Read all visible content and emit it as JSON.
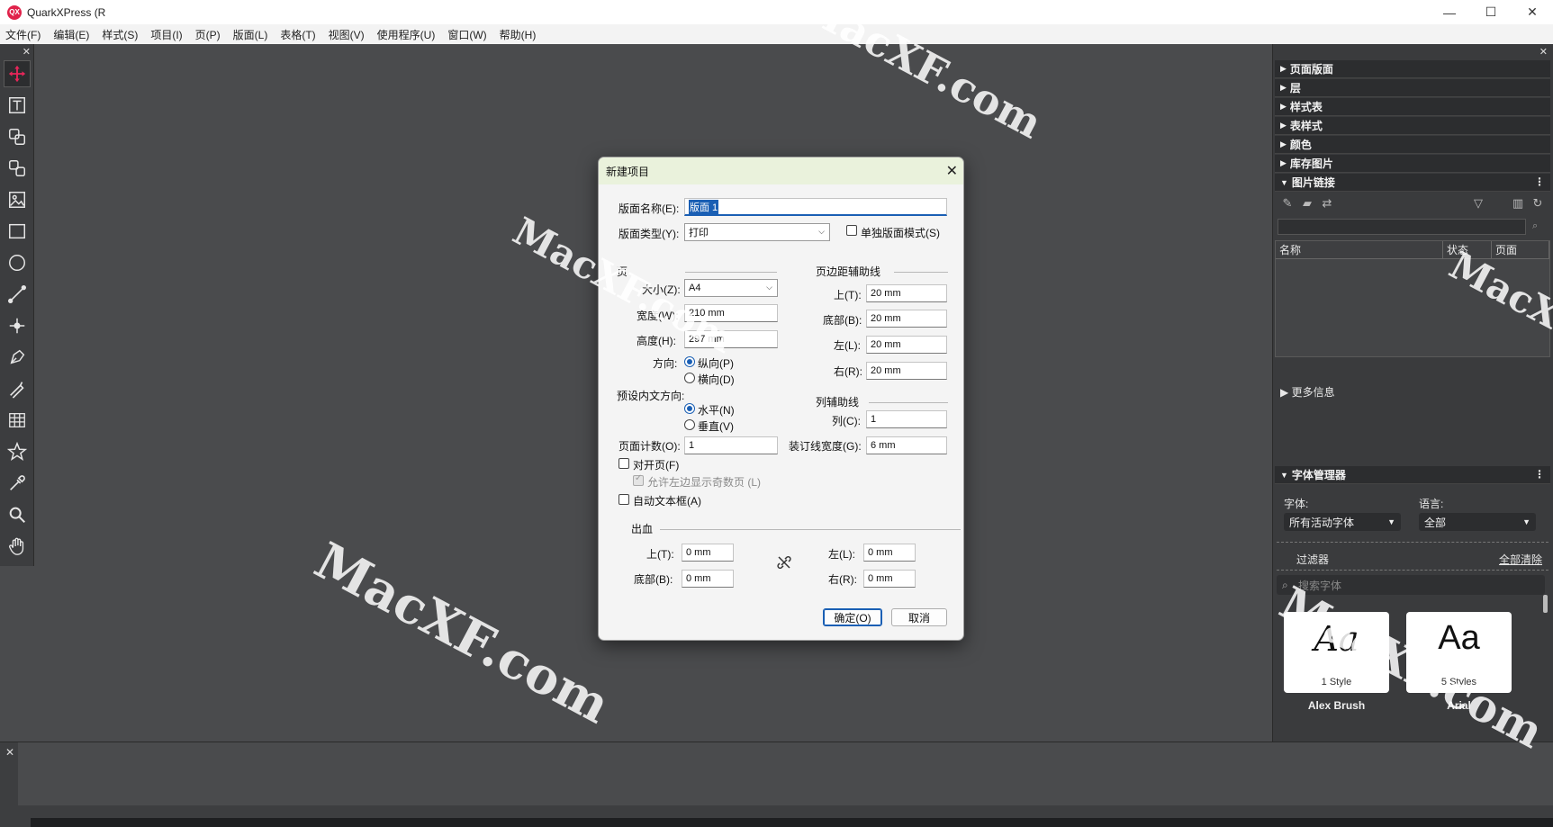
{
  "window": {
    "app_logo": "QX",
    "title": "QuarkXPress (R",
    "minimize": "—",
    "maximize": "☐",
    "close": "✕"
  },
  "menu": [
    "文件(F)",
    "编辑(E)",
    "样式(S)",
    "项目(I)",
    "页(P)",
    "版面(L)",
    "表格(T)",
    "视图(V)",
    "使用程序(U)",
    "窗口(W)",
    "帮助(H)"
  ],
  "toolbox": {
    "close": "✕",
    "tools": [
      "move-tool",
      "text-content-tool",
      "text-linking-tool",
      "text-unlinking-tool",
      "picture-content-tool",
      "rectangle-box-tool",
      "oval-box-tool",
      "line-tool",
      "bezier-tool",
      "pen-tool",
      "freehand-tool",
      "table-tool",
      "star-tool",
      "eyedropper-tool",
      "zoom-tool",
      "pan-tool"
    ]
  },
  "panels": {
    "close": "✕",
    "collapsed": [
      "页面版面",
      "层",
      "样式表",
      "表样式",
      "颜色",
      "库存图片"
    ],
    "picture_links": {
      "title": "图片链接",
      "columns": [
        "名称",
        "状态",
        "页面"
      ]
    },
    "more_info": "更多信息",
    "font_manager": {
      "title": "字体管理器",
      "font_label": "字体:",
      "font_value": "所有活动字体",
      "lang_label": "语言:",
      "lang_value": "全部",
      "filter_label": "过滤器",
      "clear_all": "全部清除",
      "search_placeholder": "搜索字体",
      "fonts": [
        {
          "sample": "Aa",
          "styles": "1 Style",
          "name": "Alex Brush"
        },
        {
          "sample": "Aa",
          "styles": "5 Styles",
          "name": "Arial"
        }
      ]
    }
  },
  "bottom": {
    "close": "✕"
  },
  "dialog": {
    "title": "新建项目",
    "close": "✕",
    "layout_name_label": "版面名称(E):",
    "layout_name_value": "版面 1",
    "layout_type_label": "版面类型(Y):",
    "layout_type_value": "打印",
    "single_layout_mode": "单独版面模式(S)",
    "page": {
      "heading": "页",
      "size_label": "大小(Z):",
      "size_value": "A4",
      "width_label": "宽度(W):",
      "width_value": "210 mm",
      "height_label": "高度(H):",
      "height_value": "297 mm",
      "orientation_label": "方向:",
      "portrait": "纵向(P)",
      "landscape": "横向(D)",
      "story_dir_label": "预设内文方向:",
      "horizontal": "水平(N)",
      "vertical": "垂直(V)",
      "page_count_label": "页面计数(O):",
      "page_count_value": "1",
      "facing_pages": "对开页(F)",
      "allow_odd_left": "允许左边显示奇数页 (L)",
      "auto_text_box": "自动文本框(A)"
    },
    "margins": {
      "heading": "页边距辅助线",
      "top_label": "上(T):",
      "top_value": "20 mm",
      "bottom_label": "底部(B):",
      "bottom_value": "20 mm",
      "left_label": "左(L):",
      "left_value": "20 mm",
      "right_label": "右(R):",
      "right_value": "20 mm"
    },
    "columns": {
      "heading": "列辅助线",
      "cols_label": "列(C):",
      "cols_value": "1",
      "gutter_label": "装订线宽度(G):",
      "gutter_value": "6 mm"
    },
    "bleed": {
      "heading": "出血",
      "top_label": "上(T):",
      "top_value": "0 mm",
      "bottom_label": "底部(B):",
      "bottom_value": "0 mm",
      "left_label": "左(L):",
      "left_value": "0 mm",
      "right_label": "右(R):",
      "right_value": "0 mm"
    },
    "ok": "确定(O)",
    "cancel": "取消"
  },
  "watermark": "MacXF.com"
}
